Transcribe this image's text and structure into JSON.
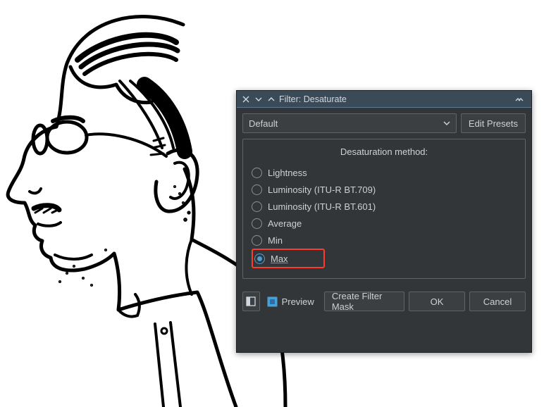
{
  "titlebar": {
    "title": "Filter: Desaturate"
  },
  "toolbar": {
    "preset_value": "Default",
    "edit_presets": "Edit Presets"
  },
  "group": {
    "title": "Desaturation method:",
    "options": [
      {
        "label": "Lightness",
        "selected": false
      },
      {
        "label": "Luminosity (ITU-R BT.709)",
        "selected": false
      },
      {
        "label": "Luminosity (ITU-R BT.601)",
        "selected": false
      },
      {
        "label": "Average",
        "selected": false
      },
      {
        "label": "Min",
        "selected": false
      },
      {
        "label": "Max",
        "selected": true
      }
    ]
  },
  "buttons": {
    "preview": "Preview",
    "create_mask": "Create Filter Mask",
    "ok": "OK",
    "cancel": "Cancel"
  }
}
